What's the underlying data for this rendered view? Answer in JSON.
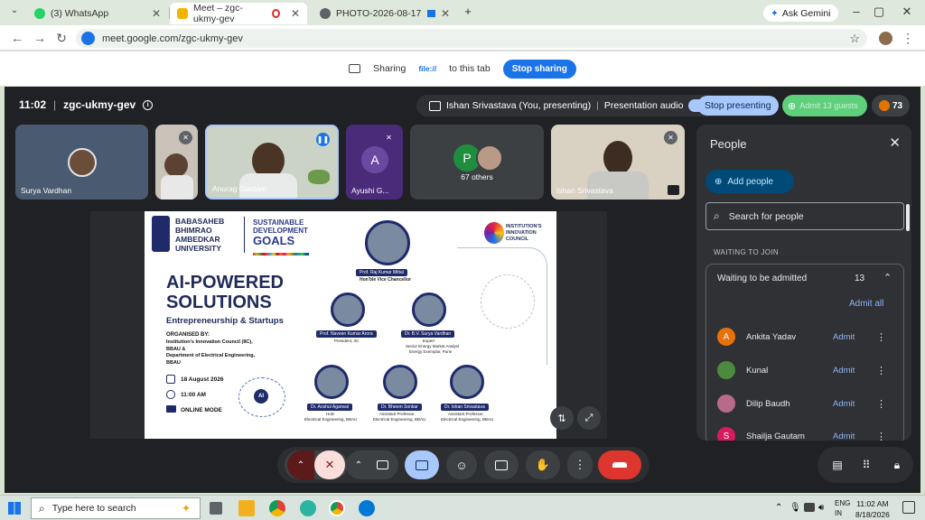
{
  "browser": {
    "tabs": [
      {
        "label": "(3) WhatsApp",
        "icon": "whatsapp-icon",
        "color": "#25d366"
      },
      {
        "label": "Meet – zgc-ukmy-gev",
        "icon": "meet-icon",
        "color": "#f4b400"
      },
      {
        "label": "PHOTO-2026-08-17-12-43-",
        "icon": "globe-icon",
        "color": "#5f6368"
      }
    ],
    "gemini_label": "Ask Gemini",
    "url": "meet.google.com/zgc-ukmy-gev"
  },
  "sharebar": {
    "sharing_label": "Sharing",
    "file_label": "file://",
    "to_tab_label": "to this tab",
    "stop_label": "Stop sharing"
  },
  "meet": {
    "time": "11:02",
    "separator": "|",
    "meeting_code": "zgc-ukmy-gev",
    "presenter_label": "Ishan Srivastava (You, presenting)",
    "audio_label": "Presentation audio",
    "stop_presenting_label": "Stop presenting",
    "admit_label": "Admit 13 guests",
    "participant_count": "73",
    "tiles": [
      {
        "name": "Surya Vardhan"
      },
      {
        "name": ""
      },
      {
        "name": "Anurag Gautam"
      },
      {
        "name": "Ayushi G...",
        "initial": "A"
      },
      {
        "name": "67 others",
        "initial": "P"
      },
      {
        "name": "Ishan Srivastava"
      }
    ]
  },
  "slide": {
    "university_lines": [
      "BABASAHEB",
      "BHIMRAO",
      "AMBEDKAR",
      "UNIVERSITY"
    ],
    "sdg_lines": [
      "SUSTAINABLE",
      "DEVELOPMENT",
      "GOALS"
    ],
    "iic_lines": [
      "INSTITUTION'S",
      "INNOVATION",
      "COUNCIL"
    ],
    "title_line1": "AI-POWERED",
    "title_line2": "SOLUTIONS",
    "subtitle": "Entrepreneurship & Startups",
    "organised_by": "ORGANISED BY:",
    "org_lines": [
      "Institution's Innovation Council (IIC),",
      "BBAU &",
      "Department of Electrical Engineering,",
      "BBAU"
    ],
    "date": "18 August 2026",
    "time": "11:00 AM",
    "mode": "ONLINE MODE",
    "ai_badge": "AI",
    "speakers": [
      {
        "name": "Prof. Raj Kumar Mittal",
        "role": "Hon'ble Vice Chancellor"
      },
      {
        "name": "Prof. Naveen Kumar Arora",
        "role": "President, IIC"
      },
      {
        "name": "Dr. B.V. Surya Vardhan",
        "role": "Expert",
        "role2": "Senior Energy Market Analyst",
        "role3": "Energy Exemplar, Pune"
      },
      {
        "name": "Dr. Anshul Agarwal",
        "role": "HoD",
        "role2": "Electrical Engineering, BBAU"
      },
      {
        "name": "Dr. Bheem Sonkar",
        "role": "Assistant Professor,",
        "role2": "Electrical Engineering, BBAU"
      },
      {
        "name": "Dr. Ishan Srivastava",
        "role": "Assistant Professor,",
        "role2": "Electrical Engineering, BBAU"
      }
    ]
  },
  "people_panel": {
    "title": "People",
    "add_people_label": "Add people",
    "search_placeholder": "Search for people",
    "waiting_section": "WAITING TO JOIN",
    "waiting_header": "Waiting to be admitted",
    "waiting_count": "13",
    "admit_all_label": "Admit all",
    "guests": [
      {
        "name": "Ankita Yadav",
        "initial": "A",
        "color": "#e8710a",
        "admit": "Admit"
      },
      {
        "name": "Kunal",
        "initial": "",
        "color": "#4e8a3e",
        "admit": "Admit"
      },
      {
        "name": "Dilip Baudh",
        "initial": "",
        "color": "#b86a8a",
        "admit": "Admit"
      },
      {
        "name": "Shailja Gautam",
        "initial": "S",
        "color": "#d81b60",
        "admit": "Admit"
      }
    ]
  },
  "taskbar": {
    "search_placeholder": "Type here to search",
    "lang1": "ENG",
    "lang2": "IN",
    "clock_time": "11:02 AM",
    "clock_date": "8/18/2026"
  }
}
